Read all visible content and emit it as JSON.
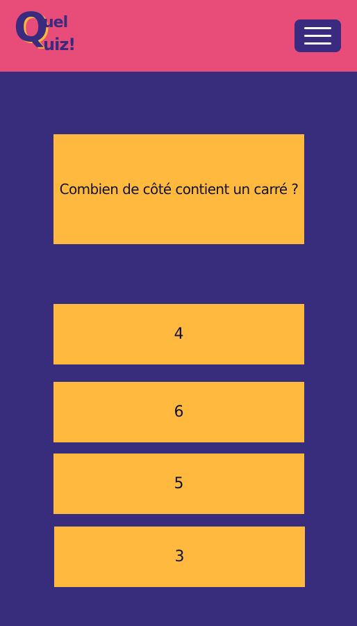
{
  "header": {
    "logo": {
      "letter": "Q",
      "line1": "uel",
      "line2": "uiz!"
    },
    "menu_icon": "hamburger-menu-icon"
  },
  "quiz": {
    "question": "Combien de côté contient un carré ?",
    "answers": [
      "4",
      "6",
      "5",
      "3"
    ]
  },
  "colors": {
    "header_bg": "#e84c78",
    "page_bg": "#382c7c",
    "card_bg": "#ffb93f",
    "logo_fg": "#3a2b80",
    "logo_shadow": "#f6b93b"
  }
}
